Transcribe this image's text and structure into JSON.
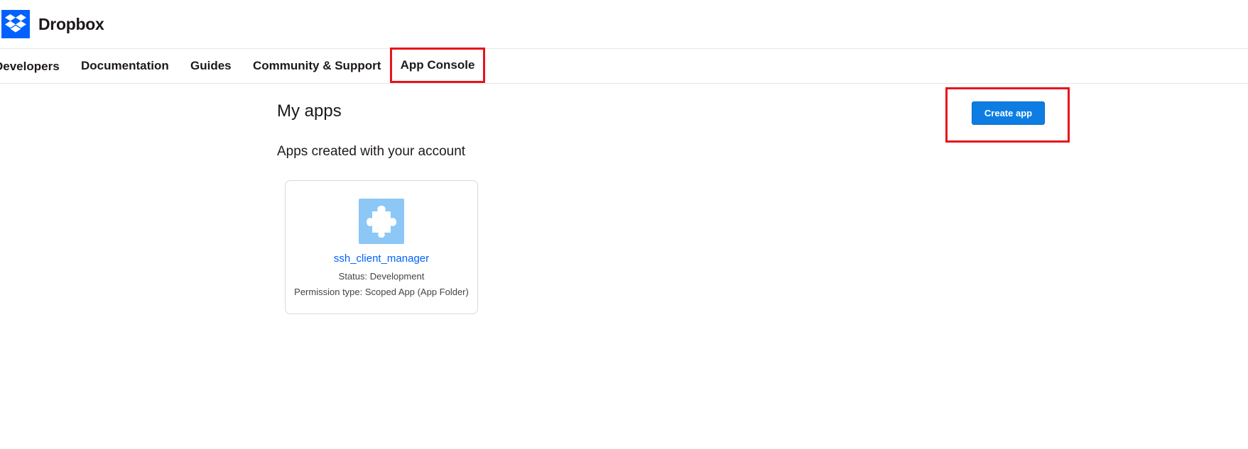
{
  "header": {
    "brand_name": "Dropbox"
  },
  "nav": {
    "developers": "Developers",
    "documentation": "Documentation",
    "guides": "Guides",
    "community": "Community & Support",
    "app_console": "App Console"
  },
  "main": {
    "title": "My apps",
    "section_title": "Apps created with your account",
    "create_button": "Create app",
    "apps": [
      {
        "name": "ssh_client_manager",
        "status": "Status: Development",
        "permission": "Permission type: Scoped App (App Folder)",
        "icon": "puzzle-piece-icon"
      }
    ]
  },
  "colors": {
    "brand_blue": "#0061fe",
    "button_blue": "#0d7de3",
    "highlight_red": "#e8131b",
    "app_icon_bg": "#8cc7f5"
  }
}
